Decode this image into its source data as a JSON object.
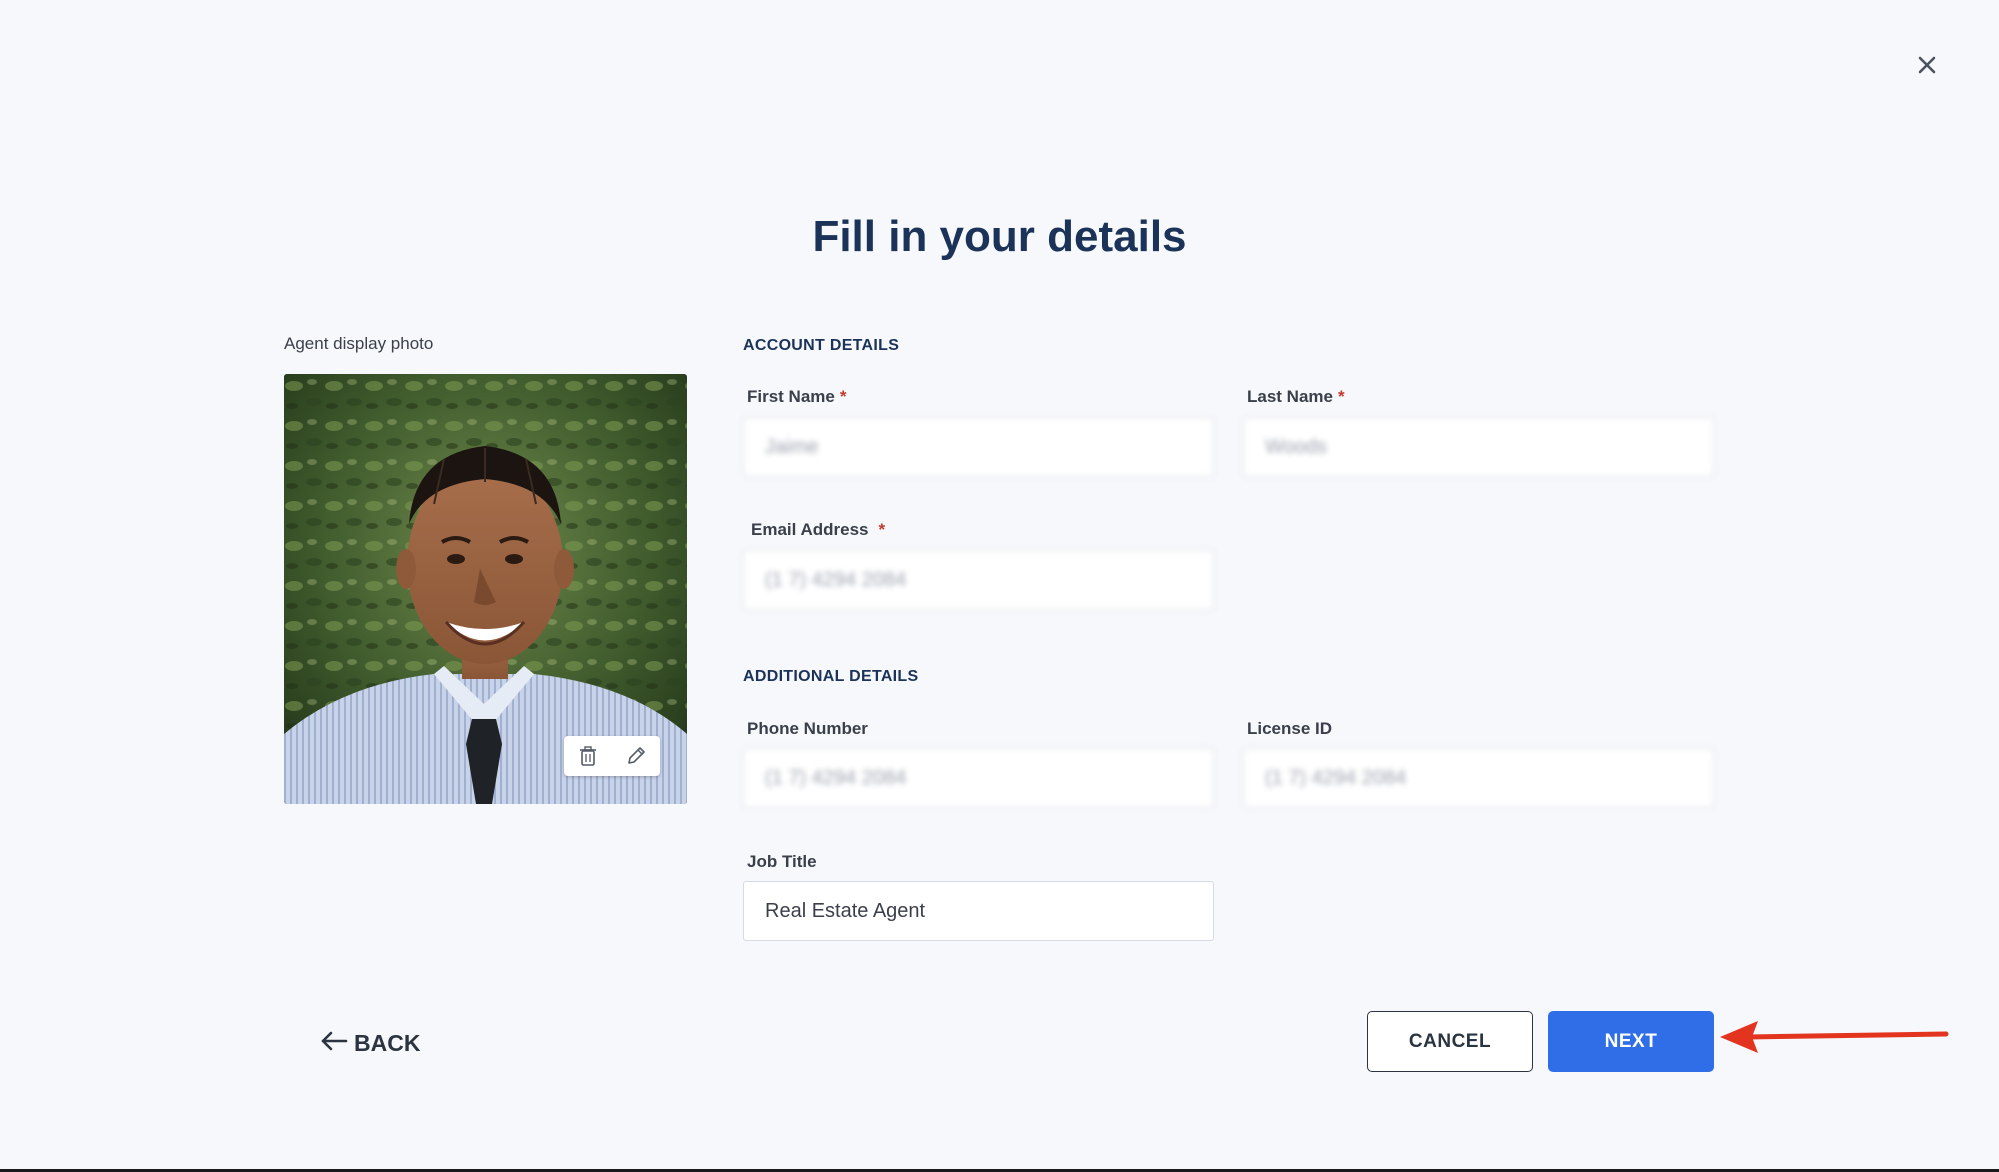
{
  "dialog": {
    "title": "Fill in your details"
  },
  "photo": {
    "label": "Agent display photo"
  },
  "account_section": {
    "heading": "ACCOUNT DETAILS",
    "first_name": {
      "label": "First Name",
      "required_mark": "*",
      "value": "Jaime"
    },
    "last_name": {
      "label": "Last Name",
      "required_mark": "*",
      "value": "Woods"
    },
    "email": {
      "label": "Email Address",
      "required_mark": "*",
      "value": "(1 7) 4294 2084"
    }
  },
  "additional_section": {
    "heading": "ADDITIONAL DETAILS",
    "phone": {
      "label": "Phone Number",
      "value": "(1 7) 4294 2084"
    },
    "license": {
      "label": "License ID",
      "value": "(1 7) 4294 2084"
    },
    "job_title": {
      "label": "Job Title",
      "value": "Real Estate Agent"
    }
  },
  "actions": {
    "back_label": "BACK",
    "cancel_label": "CANCEL",
    "next_label": "NEXT"
  },
  "colors": {
    "primary": "#2f6ee6",
    "heading": "#1b3358",
    "required": "#c0392b",
    "annotation": "#e3341f",
    "background": "#f6f8fb"
  },
  "icons": {
    "close": "close-icon",
    "delete": "trash-icon",
    "edit": "pencil-icon",
    "back": "arrow-left-icon"
  }
}
